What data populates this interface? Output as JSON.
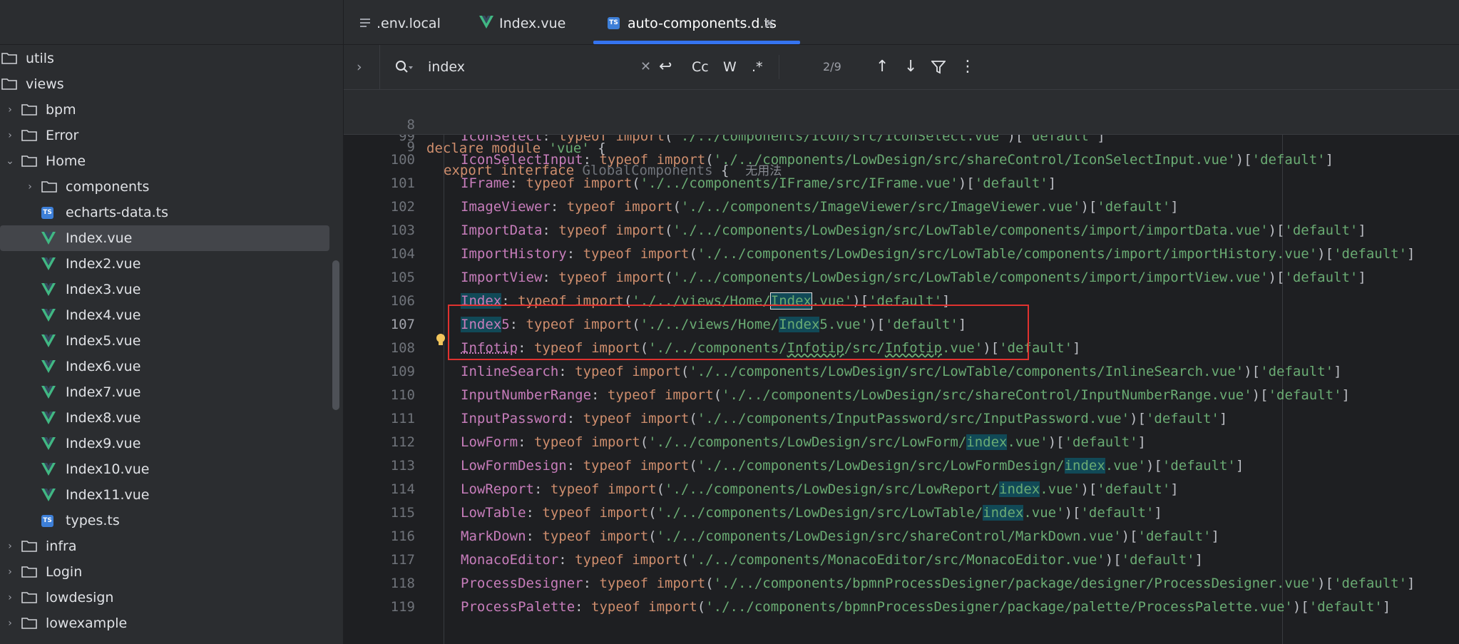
{
  "sidebar": {
    "items": [
      {
        "label": "utils",
        "kind": "folder",
        "depth": 0,
        "expanded": false
      },
      {
        "label": "views",
        "kind": "folder",
        "depth": 0,
        "expanded": true
      },
      {
        "label": "bpm",
        "kind": "folder",
        "depth": 1,
        "expanded": false
      },
      {
        "label": "Error",
        "kind": "folder",
        "depth": 1,
        "expanded": false
      },
      {
        "label": "Home",
        "kind": "folder",
        "depth": 1,
        "expanded": true
      },
      {
        "label": "components",
        "kind": "folder",
        "depth": 2,
        "expanded": false
      },
      {
        "label": "echarts-data.ts",
        "kind": "ts",
        "depth": 2
      },
      {
        "label": "Index.vue",
        "kind": "vue",
        "depth": 2,
        "selected": true
      },
      {
        "label": "Index2.vue",
        "kind": "vue",
        "depth": 2
      },
      {
        "label": "Index3.vue",
        "kind": "vue",
        "depth": 2
      },
      {
        "label": "Index4.vue",
        "kind": "vue",
        "depth": 2
      },
      {
        "label": "Index5.vue",
        "kind": "vue",
        "depth": 2
      },
      {
        "label": "Index6.vue",
        "kind": "vue",
        "depth": 2
      },
      {
        "label": "Index7.vue",
        "kind": "vue",
        "depth": 2
      },
      {
        "label": "Index8.vue",
        "kind": "vue",
        "depth": 2
      },
      {
        "label": "Index9.vue",
        "kind": "vue",
        "depth": 2
      },
      {
        "label": "Index10.vue",
        "kind": "vue",
        "depth": 2
      },
      {
        "label": "Index11.vue",
        "kind": "vue",
        "depth": 2
      },
      {
        "label": "types.ts",
        "kind": "ts",
        "depth": 2
      },
      {
        "label": "infra",
        "kind": "folder",
        "depth": 1,
        "expanded": false
      },
      {
        "label": "Login",
        "kind": "folder",
        "depth": 1,
        "expanded": false
      },
      {
        "label": "lowdesign",
        "kind": "folder",
        "depth": 1,
        "expanded": false
      },
      {
        "label": "lowexample",
        "kind": "folder",
        "depth": 1,
        "expanded": false
      }
    ]
  },
  "tabs": [
    {
      "label": ".env.local",
      "icon": "text-file-icon"
    },
    {
      "label": "Index.vue",
      "icon": "vue-icon"
    },
    {
      "label": "auto-components.d.ts",
      "icon": "ts-icon",
      "active": true
    }
  ],
  "find": {
    "query": "index",
    "match_count": "2/9",
    "case_label": "Cc",
    "word_label": "W",
    "regex_label": ".*"
  },
  "sticky": {
    "line8": {
      "num": "8",
      "text_pre": "declare module ",
      "text_str": "'vue'",
      "text_post": " {"
    },
    "line9": {
      "num": "9",
      "kw": "export interface",
      "name": "GlobalComponents",
      "brace": " {",
      "hint": "无用法"
    }
  },
  "code_lines": [
    {
      "num": "99",
      "name": "IconSelect",
      "path": "'./../components/Icon/src/IconSelect.vue'"
    },
    {
      "num": "100",
      "name": "IconSelectInput",
      "path": "'./../components/LowDesign/src/shareControl/IconSelectInput.vue'"
    },
    {
      "num": "101",
      "name": "IFrame",
      "path": "'./../components/IFrame/src/IFrame.vue'"
    },
    {
      "num": "102",
      "name": "ImageViewer",
      "path": "'./../components/ImageViewer/src/ImageViewer.vue'"
    },
    {
      "num": "103",
      "name": "ImportData",
      "path": "'./../components/LowDesign/src/LowTable/components/import/importData.vue'"
    },
    {
      "num": "104",
      "name": "ImportHistory",
      "path": "'./../components/LowDesign/src/LowTable/components/import/importHistory.vue'"
    },
    {
      "num": "105",
      "name": "ImportView",
      "path": "'./../components/LowDesign/src/LowTable/components/import/importView.vue'"
    },
    {
      "num": "106",
      "name": "Index",
      "path": "'./../views/Home/Index.vue'"
    },
    {
      "num": "107",
      "name": "Index5",
      "path": "'./../views/Home/Index5.vue'"
    },
    {
      "num": "108",
      "name": "Infotip",
      "path": "'./../components/Infotip/src/Infotip.vue'"
    },
    {
      "num": "109",
      "name": "InlineSearch",
      "path": "'./../components/LowDesign/src/LowTable/components/InlineSearch.vue'"
    },
    {
      "num": "110",
      "name": "InputNumberRange",
      "path": "'./../components/LowDesign/src/shareControl/InputNumberRange.vue'"
    },
    {
      "num": "111",
      "name": "InputPassword",
      "path": "'./../components/InputPassword/src/InputPassword.vue'"
    },
    {
      "num": "112",
      "name": "LowForm",
      "path": "'./../components/LowDesign/src/LowForm/index.vue'"
    },
    {
      "num": "113",
      "name": "LowFormDesign",
      "path": "'./../components/LowDesign/src/LowFormDesign/index.vue'"
    },
    {
      "num": "114",
      "name": "LowReport",
      "path": "'./../components/LowDesign/src/LowReport/index.vue'"
    },
    {
      "num": "115",
      "name": "LowTable",
      "path": "'./../components/LowDesign/src/LowTable/index.vue'"
    },
    {
      "num": "116",
      "name": "MarkDown",
      "path": "'./../components/LowDesign/src/shareControl/MarkDown.vue'"
    },
    {
      "num": "117",
      "name": "MonacoEditor",
      "path": "'./../components/MonacoEditor/src/MonacoEditor.vue'"
    },
    {
      "num": "118",
      "name": "ProcessDesigner",
      "path": "'./../components/bpmnProcessDesigner/package/designer/ProcessDesigner.vue'"
    },
    {
      "num": "119",
      "name": "ProcessPalette",
      "path": "'./../components/bpmnProcessDesigner/package/palette/ProcessPalette.vue'"
    }
  ],
  "code_tokens": {
    "colon": ": ",
    "typeof": "typeof",
    "import": "import",
    "default": "['default']"
  },
  "colors": {
    "accent": "#3574f0",
    "highlight_box": "#e0322f",
    "search_match": "#114957",
    "string": "#6aab73",
    "keyword": "#cf8e6d",
    "property": "#c77dbb"
  }
}
